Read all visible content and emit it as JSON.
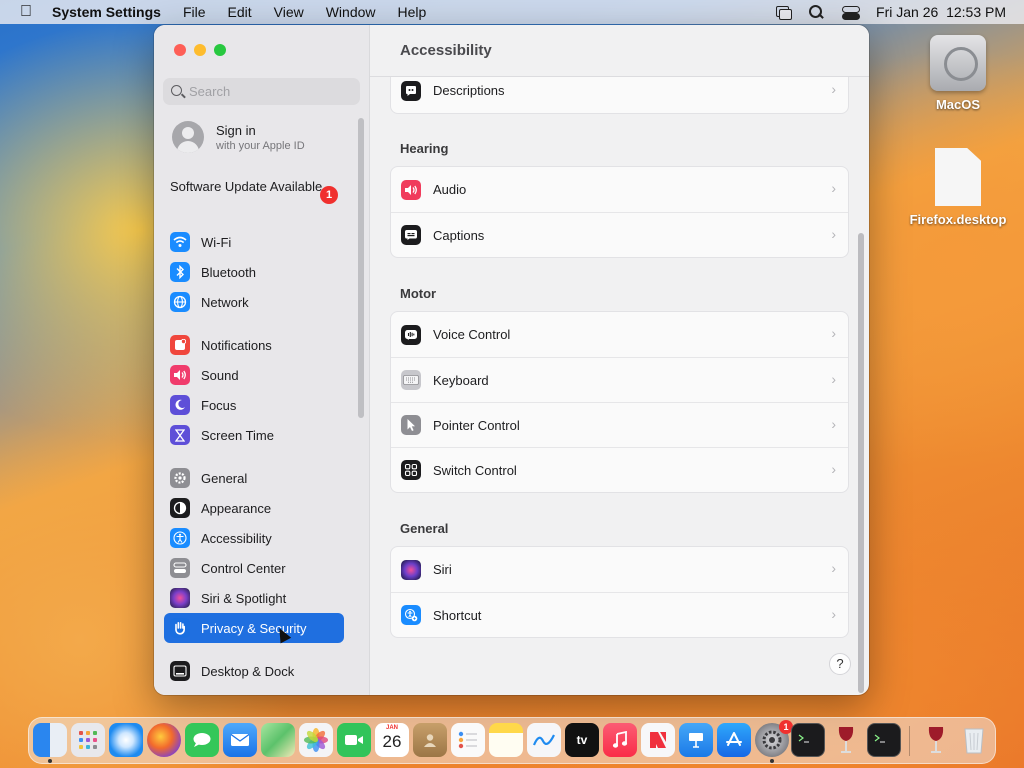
{
  "menubar": {
    "app_name": "System Settings",
    "menus": [
      "File",
      "Edit",
      "View",
      "Window",
      "Help"
    ],
    "clock": "Fri Jan 26  12:53 PM"
  },
  "desktop": {
    "icons": [
      {
        "label": "MacOS",
        "icon": "hard-disk-icon"
      },
      {
        "label": "Firefox.desktop",
        "icon": "document-icon"
      }
    ]
  },
  "sidebar": {
    "search_placeholder": "Search",
    "signin": {
      "title": "Sign in",
      "subtitle": "with your Apple ID"
    },
    "update": {
      "label": "Software Update Available",
      "badge": "1"
    },
    "items": [
      {
        "label": "Wi-Fi",
        "icon": "wifi-icon",
        "color": "#1a8cff"
      },
      {
        "label": "Bluetooth",
        "icon": "bluetooth-icon",
        "color": "#1a8cff"
      },
      {
        "label": "Network",
        "icon": "globe-icon",
        "color": "#1a8cff"
      },
      {
        "label": "Notifications",
        "icon": "bell-icon",
        "color": "#f0473d"
      },
      {
        "label": "Sound",
        "icon": "speaker-icon",
        "color": "#f03c6c"
      },
      {
        "label": "Focus",
        "icon": "moon-icon",
        "color": "#5e4fd8"
      },
      {
        "label": "Screen Time",
        "icon": "hourglass-icon",
        "color": "#5e4fd8"
      },
      {
        "label": "General",
        "icon": "gear-icon",
        "color": "#8e8e93"
      },
      {
        "label": "Appearance",
        "icon": "appearance-icon",
        "color": "#1c1c1e"
      },
      {
        "label": "Accessibility",
        "icon": "accessibility-icon",
        "color": "#1a8cff"
      },
      {
        "label": "Control Center",
        "icon": "control-center-icon",
        "color": "#8e8e93"
      },
      {
        "label": "Siri & Spotlight",
        "icon": "siri-icon",
        "color": "#7b3fc9"
      },
      {
        "label": "Privacy & Security",
        "icon": "hand-icon",
        "color": "#1a6fe0"
      },
      {
        "label": "Desktop & Dock",
        "icon": "dock-icon",
        "color": "#1c1c1e"
      }
    ],
    "selected": "Privacy & Security"
  },
  "content": {
    "title": "Accessibility",
    "top_row": {
      "label": "Descriptions",
      "icon": "descriptions-icon",
      "color": "#1c1c1e"
    },
    "sections": [
      {
        "heading": "Hearing",
        "rows": [
          {
            "label": "Audio",
            "icon": "audio-icon",
            "color": "#f03c5c"
          },
          {
            "label": "Captions",
            "icon": "captions-icon",
            "color": "#1c1c1e"
          }
        ]
      },
      {
        "heading": "Motor",
        "rows": [
          {
            "label": "Voice Control",
            "icon": "voice-control-icon",
            "color": "#1c1c1e"
          },
          {
            "label": "Keyboard",
            "icon": "keyboard-icon",
            "color": "#c7c7cc"
          },
          {
            "label": "Pointer Control",
            "icon": "pointer-icon",
            "color": "#8e8e93"
          },
          {
            "label": "Switch Control",
            "icon": "switch-control-icon",
            "color": "#1c1c1e"
          }
        ]
      },
      {
        "heading": "General",
        "rows": [
          {
            "label": "Siri",
            "icon": "siri-icon",
            "color": "#6b3fc9"
          },
          {
            "label": "Shortcut",
            "icon": "shortcut-icon",
            "color": "#1a8cff"
          }
        ]
      }
    ],
    "help": "?"
  },
  "dock": {
    "apps": [
      {
        "name": "Finder",
        "icon": "finder-icon",
        "color": "#2f8df4",
        "running": true
      },
      {
        "name": "Launchpad",
        "icon": "launchpad-icon",
        "color": "#e8e8ec"
      },
      {
        "name": "Safari",
        "icon": "safari-icon",
        "color": "#1f8bf0"
      },
      {
        "name": "Firefox",
        "icon": "firefox-icon",
        "color": "#7a3fd6"
      },
      {
        "name": "Messages",
        "icon": "messages-icon",
        "color": "#34c759"
      },
      {
        "name": "Mail",
        "icon": "mail-icon",
        "color": "#2a8cf3"
      },
      {
        "name": "Maps",
        "icon": "maps-icon",
        "color": "#5cc26b"
      },
      {
        "name": "Photos",
        "icon": "photos-icon",
        "color": "#f4f4f6"
      },
      {
        "name": "FaceTime",
        "icon": "facetime-icon",
        "color": "#32c45a"
      },
      {
        "name": "Calendar",
        "icon": "calendar-icon",
        "color": "#ffffff",
        "month": "JAN",
        "day": "26"
      },
      {
        "name": "Contacts",
        "icon": "contacts-icon",
        "color": "#b08b5a"
      },
      {
        "name": "Reminders",
        "icon": "reminders-icon",
        "color": "#fafafa"
      },
      {
        "name": "Notes",
        "icon": "notes-icon",
        "color": "#ffd84a"
      },
      {
        "name": "Freeform",
        "icon": "freeform-icon",
        "color": "#f6f6f8"
      },
      {
        "name": "TV",
        "icon": "tv-icon",
        "color": "#111111",
        "text": "tv"
      },
      {
        "name": "Music",
        "icon": "music-icon",
        "color": "#fa3b54"
      },
      {
        "name": "News",
        "icon": "news-icon",
        "color": "#f7f7f9"
      },
      {
        "name": "Keynote",
        "icon": "keynote-icon",
        "color": "#2c8ff0"
      },
      {
        "name": "App Store",
        "icon": "app-store-icon",
        "color": "#1b8cf3"
      },
      {
        "name": "System Settings",
        "icon": "system-settings-icon",
        "color": "#8e8e93",
        "badge": "1",
        "running": true
      },
      {
        "name": "Terminal",
        "icon": "terminal-icon",
        "color": "#1b1b1d"
      },
      {
        "name": "Wine",
        "icon": "wine-icon",
        "color": "#9e1b2a"
      },
      {
        "name": "Terminal",
        "icon": "terminal-icon",
        "color": "#1b1b1d"
      },
      {
        "name": "Wine",
        "icon": "wine-icon",
        "color": "#9e1b2a"
      },
      {
        "name": "Trash",
        "icon": "trash-icon",
        "color": "#e9edf1"
      }
    ]
  }
}
